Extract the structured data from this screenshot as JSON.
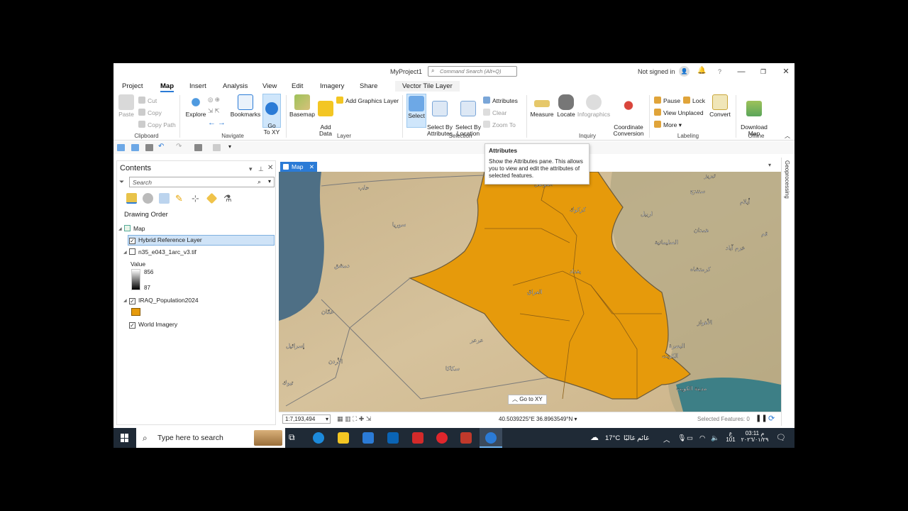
{
  "window": {
    "title": "MyProject1",
    "command_search_placeholder": "Command Search (Alt+Q)",
    "signin_status": "Not signed in"
  },
  "menu_tabs": [
    "Project",
    "Map",
    "Insert",
    "Analysis",
    "View",
    "Edit",
    "Imagery",
    "Share",
    "Vector Tile Layer"
  ],
  "active_tab": "Map",
  "ribbon": {
    "clipboard": {
      "label": "Clipboard",
      "paste": "Paste",
      "cut": "Cut",
      "copy": "Copy",
      "copy_path": "Copy Path"
    },
    "navigate": {
      "label": "Navigate",
      "explore": "Explore",
      "bookmarks": "Bookmarks",
      "goto_xy": "Go\nTo XY"
    },
    "layer": {
      "label": "Layer",
      "basemap": "Basemap",
      "add_data": "Add\nData",
      "add_graphics": "Add Graphics Layer"
    },
    "selection": {
      "label": "Selection",
      "select": "Select",
      "select_by_attr": "Select By\nAttributes",
      "select_by_loc": "Select By\nLocation",
      "attributes": "Attributes",
      "clear": "Clear",
      "zoom_to": "Zoom To"
    },
    "inquiry": {
      "label": "Inquiry",
      "measure": "Measure",
      "locate": "Locate",
      "infographics": "Infographics",
      "coord_conv": "Coordinate\nConversion"
    },
    "labeling": {
      "label": "Labeling",
      "pause": "Pause",
      "lock": "Lock",
      "view_unplaced": "View Unplaced",
      "more": "More",
      "convert": "Convert"
    },
    "offline": {
      "label": "Offline",
      "download_map": "Download\nMap"
    }
  },
  "tooltip": {
    "title": "Attributes",
    "body": "Show the Attributes pane. This allows you to view and edit the attributes of selected features."
  },
  "contents": {
    "title": "Contents",
    "search_placeholder": "Search",
    "drawing_order": "Drawing Order",
    "map_node": "Map",
    "layers": [
      {
        "name": "Hybrid Reference Layer",
        "checked": true,
        "selected": true
      },
      {
        "name": "n35_e043_1arc_v3.tif",
        "checked": false
      },
      {
        "name": "IRAQ_Population2024",
        "checked": true
      },
      {
        "name": "World Imagery",
        "checked": true
      }
    ],
    "raster_legend": {
      "label": "Value",
      "max": "856",
      "min": "87"
    },
    "polygon_color": "#e69a0b"
  },
  "mapview": {
    "tab_label": "Map",
    "scale": "1:7,193,494",
    "coordinates": "40.5039225°E 36.8963549°N",
    "selected_features": "Selected Features: 0",
    "goto_xy": "Go to XY",
    "map_labels": [
      "سوريا",
      "العراق",
      "بغداد",
      "كركوك",
      "دمشق",
      "عمّان",
      "إسرائيل",
      "الأردن",
      "عرعر",
      "سكاكا",
      "الكويت",
      "البصرة",
      "الأهواز",
      "حلب",
      "الموصل",
      "اربيل",
      "السليمانية",
      "همدان",
      "كرمنشاه",
      "خرم آباد",
      "سنندج",
      "تبريز",
      "تبوك",
      "مدينة الكويت",
      "أيلام",
      "قم"
    ],
    "side_panel": "Geoprocessing"
  },
  "taskbar": {
    "search_placeholder": "Type here to search",
    "weather": "17°C",
    "weather_text": "غائم غالبًا",
    "time": "03:11 م",
    "date": "٢٠٢٦/٠١/٢٩",
    "lang_top": "ع",
    "lang_bottom": "101"
  }
}
